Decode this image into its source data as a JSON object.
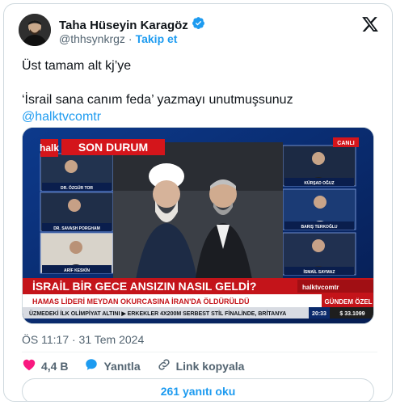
{
  "author": {
    "name": "Taha Hüseyin Karagöz",
    "handle": "@thhsynkrgz",
    "follow_label": "Takip et"
  },
  "tweet": {
    "line1": "Üst tamam alt kj’ye",
    "line2": "‘İsrail sana canım feda’ yazmayı unutmuşsunuz",
    "mention": "@halktvcomtr",
    "timestamp": "ÖS 11:17 · 31 Tem 2024"
  },
  "media": {
    "channel_logo": "halk",
    "channel_logo_sub": "HABER",
    "son_durum": "SON DURUM",
    "live_label": "CANLI",
    "headline_main": "İSRAİL BİR GECE ANSIZIN NASIL GELDİ?",
    "headline_sub": "HAMAS LİDERİ MEYDAN OKURCASINA İRAN'DA ÖLDÜRÜLDÜ",
    "handle_tag": "halktvcomtr",
    "program_tag": "GÜNDEM ÖZEL",
    "ticker": "ÜZMEDEKİ İLK OLİMPİYAT ALTINI  ▶ ERKEKLER 4X200M SERBEST STİL FİNALİNDE, BRİTANYA",
    "ticker_time": "20:33",
    "ticker_value": "$ 33.1099",
    "guests_left": [
      {
        "name": "DR. ÖZGÜR TOR",
        "title": "İSTANBUL MİLLİ. ÜNİV. ÖĞR. Ü."
      },
      {
        "name": "DR. SAVASH PORGHAM",
        "title": "GAZETECİ"
      },
      {
        "name": "ARİF KESKİN",
        "title": "ORTADOĞU UZMANI"
      }
    ],
    "guests_right": [
      {
        "name": "KÜRŞAD OĞUZ",
        "title": ""
      },
      {
        "name": "BARIŞ TERKOĞLU",
        "title": ""
      },
      {
        "name": "İSMAİL SAYMAZ",
        "title": "HALK TV PROGRAMCISI"
      }
    ]
  },
  "actions": {
    "likes": "4,4 B",
    "reply_label": "Yanıtla",
    "copy_link_label": "Link kopyala",
    "read_replies_label": "261 yanıtı oku"
  },
  "colors": {
    "accent": "#1d9bf0",
    "like": "#f91880",
    "verified": "#1d9bf0",
    "tv_red": "#d4151b",
    "tv_blue": "#0a2a6b"
  }
}
